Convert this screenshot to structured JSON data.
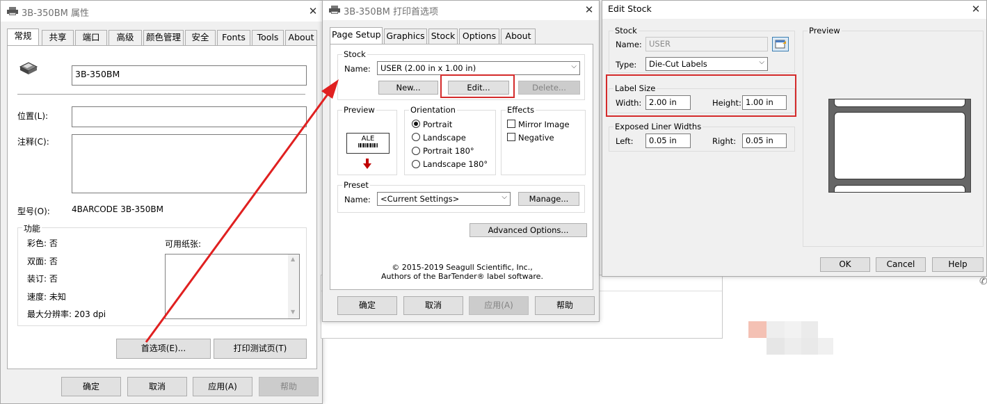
{
  "win1": {
    "title": "3B-350BM 属性",
    "tabs": [
      "常规",
      "共享",
      "端口",
      "高级",
      "颜色管理",
      "安全",
      "Fonts",
      "Tools",
      "About"
    ],
    "printer_name": "3B-350BM",
    "location_label": "位置(L):",
    "location_value": "",
    "comment_label": "注释(C):",
    "comment_value": "",
    "model_label": "型号(O):",
    "model_value": "4BARCODE 3B-350BM",
    "features_label": "功能",
    "color": "彩色: 否",
    "duplex": "双面: 否",
    "staple": "装订: 否",
    "speed": "速度: 未知",
    "max_res": "最大分辨率: 203 dpi",
    "paper_label": "可用纸张:",
    "pref_button": "首选项(E)...",
    "test_button": "打印测试页(T)",
    "ok": "确定",
    "cancel": "取消",
    "apply": "应用(A)",
    "help": "帮助"
  },
  "win2": {
    "title": "3B-350BM 打印首选项",
    "tabs": [
      "Page Setup",
      "Graphics",
      "Stock",
      "Options",
      "About"
    ],
    "stock_label": "Stock",
    "name_label": "Name:",
    "name_value": "USER (2.00 in x 1.00 in)",
    "new_btn": "New...",
    "edit_btn": "Edit...",
    "delete_btn": "Delete...",
    "preview_label": "Preview",
    "preview_text": "ALE",
    "orientation_label": "Orientation",
    "portrait": "Portrait",
    "landscape": "Landscape",
    "portrait180": "Portrait 180°",
    "landscape180": "Landscape 180°",
    "effects_label": "Effects",
    "mirror": "Mirror Image",
    "negative": "Negative",
    "preset_label": "Preset",
    "preset_name_label": "Name:",
    "preset_value": "<Current Settings>",
    "manage_btn": "Manage...",
    "advanced_btn": "Advanced Options...",
    "copyright1": "© 2015-2019 Seagull Scientific, Inc.,",
    "copyright2": "Authors of the BarTender® label software.",
    "ok": "确定",
    "cancel": "取消",
    "apply": "应用(A)",
    "help": "帮助"
  },
  "win3": {
    "title": "Edit Stock",
    "stock_label": "Stock",
    "name_label": "Name:",
    "name_value": "USER",
    "type_label": "Type:",
    "type_value": "Die-Cut Labels",
    "label_size_label": "Label Size",
    "width_label": "Width:",
    "width_value": "2.00 in",
    "height_label": "Height:",
    "height_value": "1.00 in",
    "liner_label": "Exposed Liner Widths",
    "left_label": "Left:",
    "left_value": "0.05 in",
    "right_label": "Right:",
    "right_value": "0.05 in",
    "preview_label": "Preview",
    "ok": "OK",
    "cancel": "Cancel",
    "help": "Help"
  },
  "colors": {
    "highlight_red": "#d42a2a",
    "dialog_bg": "#f0f0f0"
  },
  "icons": [
    "printer-icon",
    "close-icon",
    "chevron-down-icon",
    "stock-browse-icon"
  ]
}
